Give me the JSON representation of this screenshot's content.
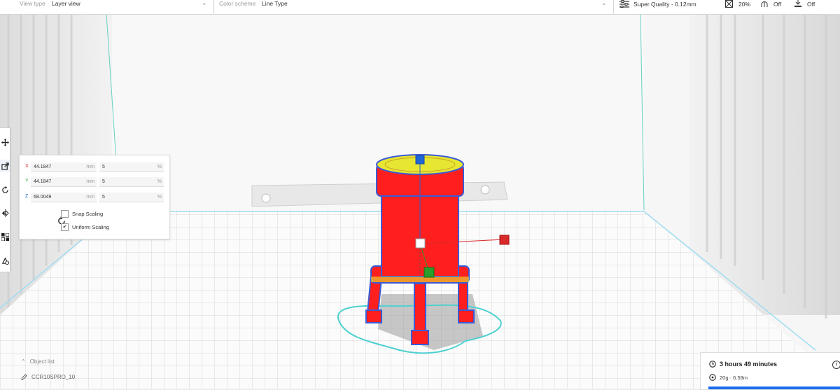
{
  "topbar": {
    "view_type_label": "View type",
    "view_type_value": "Layer view",
    "color_scheme_label": "Color scheme",
    "color_scheme_value": "Line Type",
    "profile": "Super Quality - 0.12mm",
    "infill": "20%",
    "support": "Off",
    "adhesion": "Off"
  },
  "left_toolbar": {
    "icons": [
      "move-icon",
      "scale-icon",
      "rotate-icon",
      "mirror-icon",
      "per-model-settings-icon",
      "support-blocker-icon"
    ]
  },
  "scale_panel": {
    "x": {
      "axis": "X",
      "mm": "44.1847",
      "mm_unit": "mm",
      "percent": "5",
      "pct_unit": "%"
    },
    "y": {
      "axis": "Y",
      "mm": "44.1847",
      "mm_unit": "mm",
      "percent": "5",
      "pct_unit": "%"
    },
    "z": {
      "axis": "Z",
      "mm": "68.0049",
      "mm_unit": "mm",
      "percent": "5",
      "pct_unit": "%"
    },
    "snap_scaling": {
      "label": "Snap Scaling",
      "checked": false
    },
    "uniform_scaling": {
      "label": "Uniform Scaling",
      "checked": true
    }
  },
  "object_list": {
    "title": "Object list",
    "machine_name": "CCR10SPRO_10"
  },
  "print_info": {
    "time": "3 hours 49 minutes",
    "material": "20g · 6.58m",
    "info_icon": "i"
  },
  "colors": {
    "axis_x": "#d92a2a",
    "axis_y": "#2a9d2a",
    "axis_z": "#2067d6",
    "model_fill": "#ff1f1f",
    "model_outline": "#3b5bd6",
    "skirt": "#4fd0d0",
    "top_skin": "#e6e633",
    "progress_bar": "#196ef0"
  }
}
